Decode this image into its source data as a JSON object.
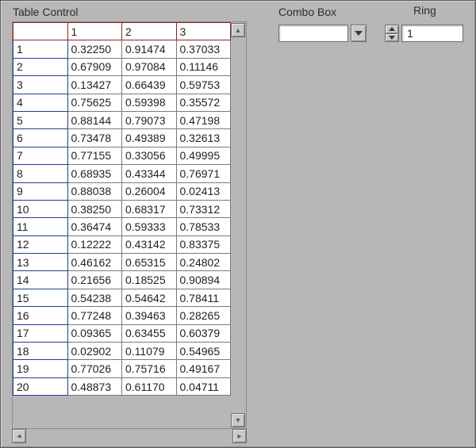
{
  "labels": {
    "table": "Table Control",
    "combo": "Combo Box",
    "ring": "Ring"
  },
  "table": {
    "column_headers": [
      "1",
      "2",
      "3"
    ],
    "row_headers": [
      "1",
      "2",
      "3",
      "4",
      "5",
      "6",
      "7",
      "8",
      "9",
      "10",
      "11",
      "12",
      "13",
      "14",
      "15",
      "16",
      "17",
      "18",
      "19",
      "20"
    ],
    "cells": [
      [
        "0.32250",
        "0.91474",
        "0.37033"
      ],
      [
        "0.67909",
        "0.97084",
        "0.11146"
      ],
      [
        "0.13427",
        "0.66439",
        "0.59753"
      ],
      [
        "0.75625",
        "0.59398",
        "0.35572"
      ],
      [
        "0.88144",
        "0.79073",
        "0.47198"
      ],
      [
        "0.73478",
        "0.49389",
        "0.32613"
      ],
      [
        "0.77155",
        "0.33056",
        "0.49995"
      ],
      [
        "0.68935",
        "0.43344",
        "0.76971"
      ],
      [
        "0.88038",
        "0.26004",
        "0.02413"
      ],
      [
        "0.38250",
        "0.68317",
        "0.73312"
      ],
      [
        "0.36474",
        "0.59333",
        "0.78533"
      ],
      [
        "0.12222",
        "0.43142",
        "0.83375"
      ],
      [
        "0.46162",
        "0.65315",
        "0.24802"
      ],
      [
        "0.21656",
        "0.18525",
        "0.90894"
      ],
      [
        "0.54238",
        "0.54642",
        "0.78411"
      ],
      [
        "0.77248",
        "0.39463",
        "0.28265"
      ],
      [
        "0.09365",
        "0.63455",
        "0.60379"
      ],
      [
        "0.02902",
        "0.11079",
        "0.54965"
      ],
      [
        "0.77026",
        "0.75716",
        "0.49167"
      ],
      [
        "0.48873",
        "0.61170",
        "0.04711"
      ]
    ]
  },
  "combo": {
    "value": ""
  },
  "ring": {
    "value": "1"
  }
}
